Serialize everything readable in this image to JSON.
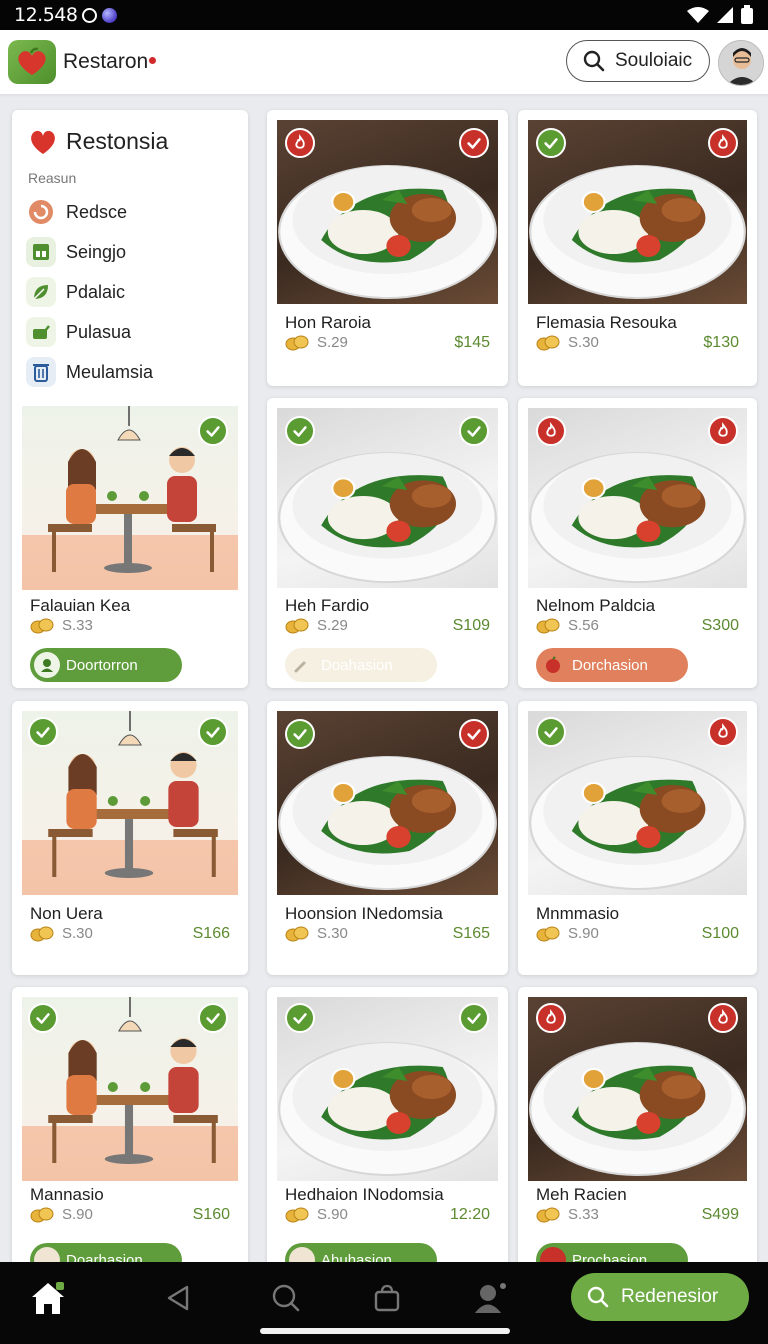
{
  "status_bar": {
    "time": "12.548"
  },
  "app_bar": {
    "title": "Restaron",
    "search_label": "Souloiaic"
  },
  "sidebar": {
    "title": "Restonsia",
    "section_label": "Reasun",
    "items": [
      {
        "label": "Redsce",
        "icon": "swirl-icon"
      },
      {
        "label": "Seingjo",
        "icon": "grid-icon"
      },
      {
        "label": "Pdalaic",
        "icon": "leaf-icon"
      },
      {
        "label": "Pulasua",
        "icon": "check-leaf-icon"
      },
      {
        "label": "Meulamsia",
        "icon": "trash-icon"
      }
    ],
    "featured": {
      "name": "Falauian Kea",
      "meta": "S.33",
      "action": "Doortorron"
    }
  },
  "cards": [
    {
      "name": "Hon Raroia",
      "meta": "S.29",
      "price": "$145"
    },
    {
      "name": "Flemasia Resouka",
      "meta": "S.30",
      "price": "$130"
    },
    {
      "name": "Heh Fardio",
      "meta": "S.29",
      "price": "S109",
      "action": "Doahasion"
    },
    {
      "name": "Nelnom Paldcia",
      "meta": "S.56",
      "price": "S300",
      "action": "Dorchasion"
    },
    {
      "name": "Non Uera",
      "meta": "S.30",
      "price": "S166"
    },
    {
      "name": "Hoonsion INedomsia",
      "meta": "S.30",
      "price": "S165"
    },
    {
      "name": "Mnmmasio",
      "meta": "S.90",
      "price": "S100"
    },
    {
      "name": "Mannasio",
      "meta": "S.90",
      "price": "S160",
      "action": "Doarhasion"
    },
    {
      "name": "Hedhaion INodomsia",
      "meta": "S.90",
      "price": "12:20",
      "action": "Ahuhasion"
    },
    {
      "name": "Meh Racien",
      "meta": "S.33",
      "price": "S499",
      "action": "Prochasion"
    }
  ],
  "bottom_nav": {
    "cta_label": "Redenesior"
  },
  "colors": {
    "accent_green": "#6fab45",
    "badge_red": "#c8302a",
    "price_green": "#5b8a2f",
    "action_orange": "#e0805c"
  }
}
